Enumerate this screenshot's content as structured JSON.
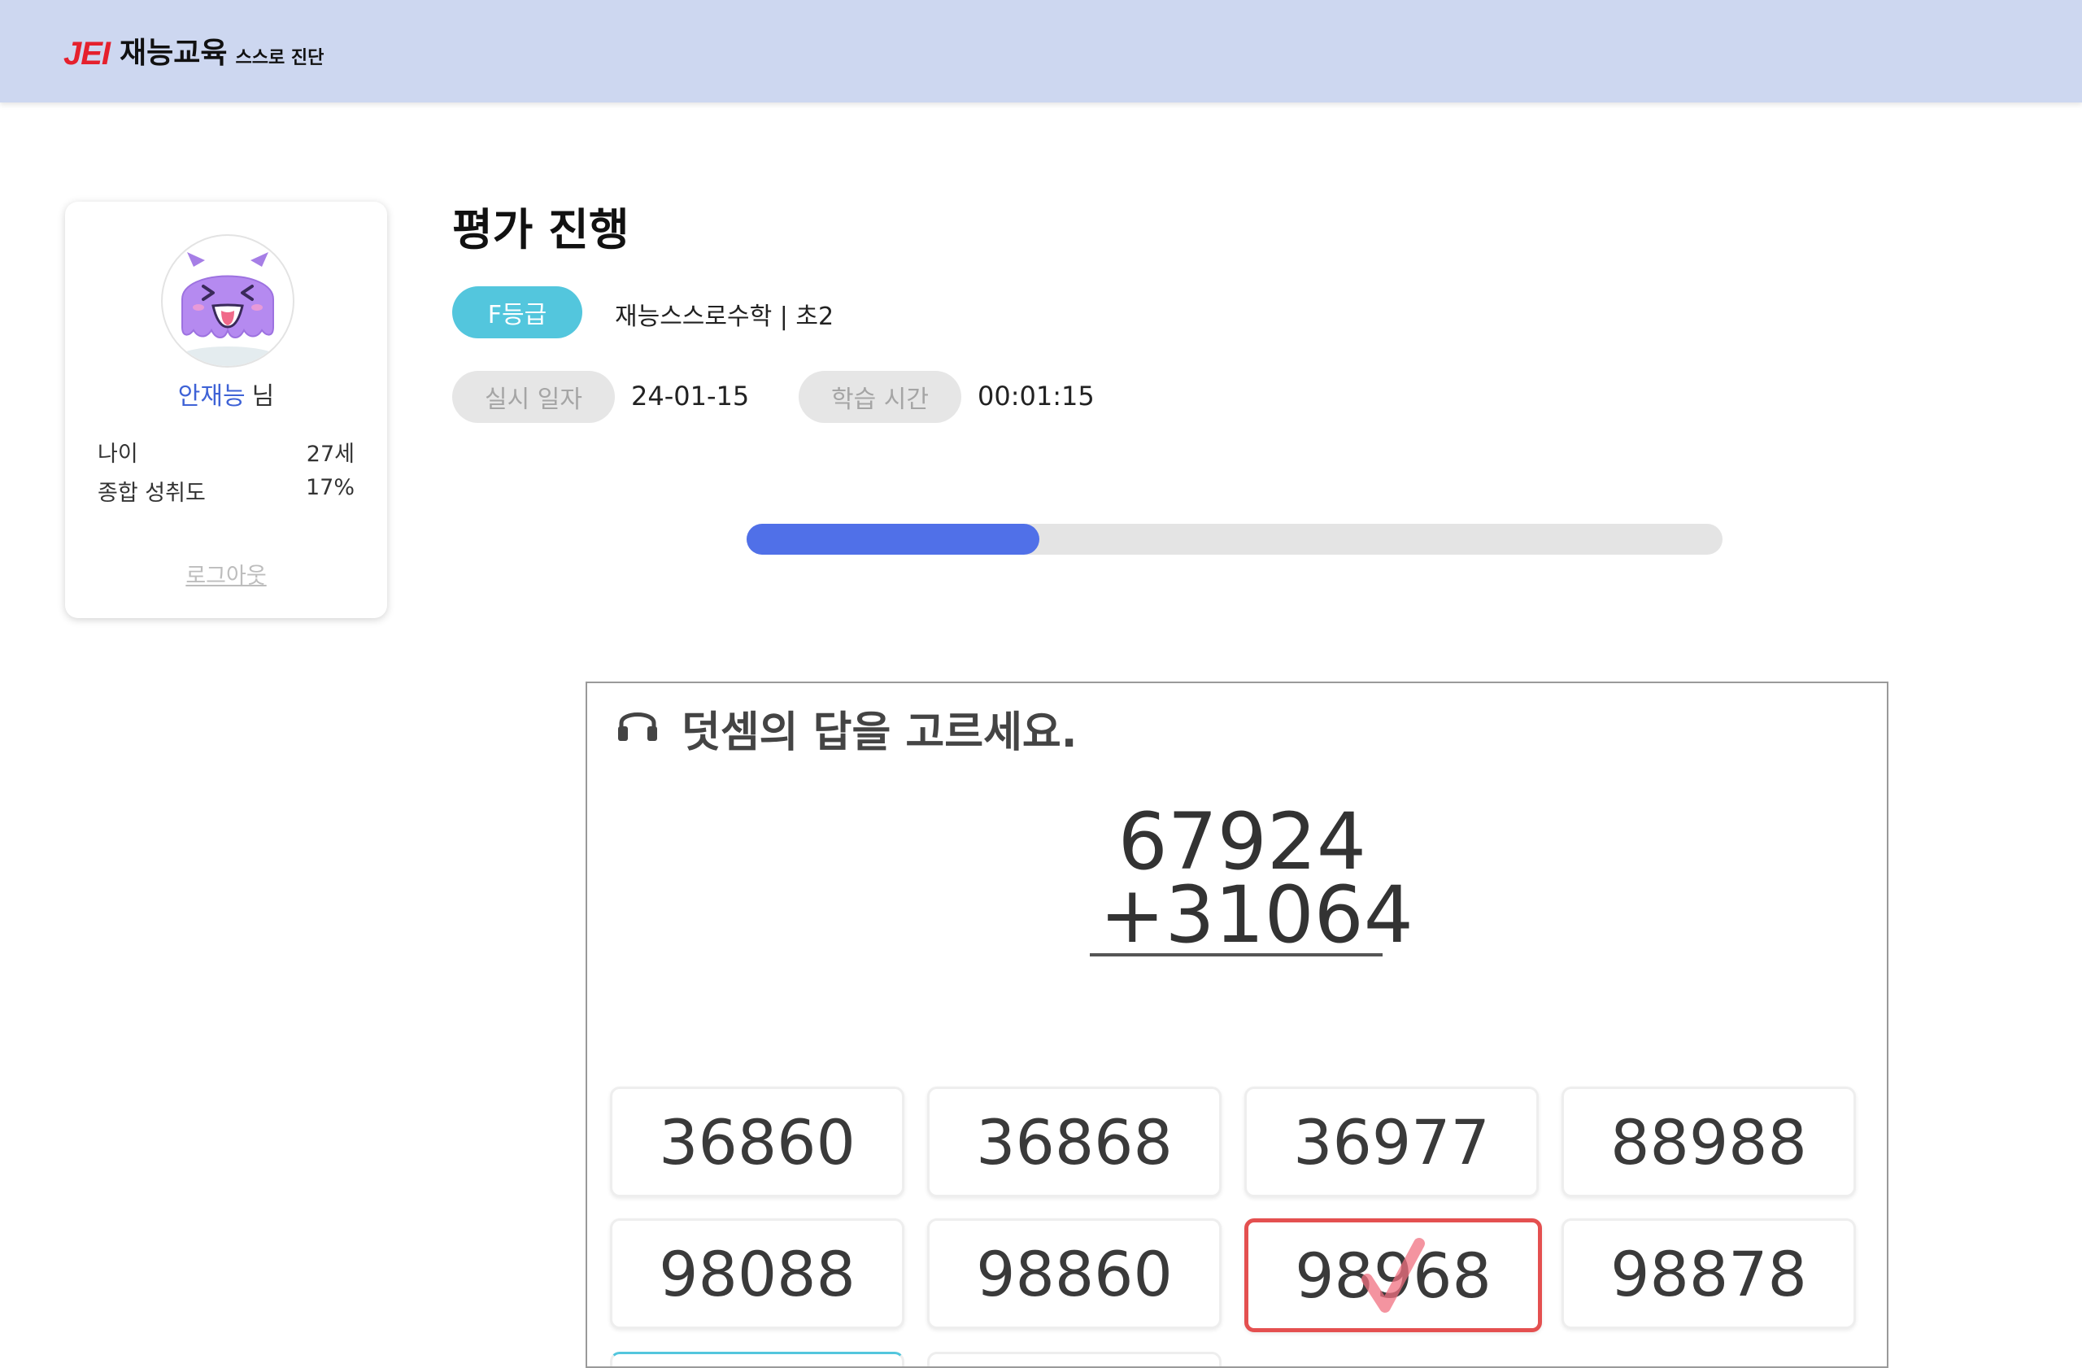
{
  "header": {
    "logo_jei": "JEI",
    "logo_brand": "재능교육",
    "logo_sub": "스스로 진단"
  },
  "profile": {
    "avatar": "purple-monster-avatar",
    "name": "안재능",
    "suffix": "님",
    "stats": [
      {
        "label": "나이",
        "value": "27세"
      },
      {
        "label": "종합 성취도",
        "value": "17%"
      }
    ],
    "logout_label": "로그아웃"
  },
  "main": {
    "title": "평가 진행",
    "grade_badge": "F등급",
    "course": "재능스스로수학 | 초2",
    "date_label": "실시 일자",
    "date_value": "24-01-15",
    "time_label": "학습 시간",
    "time_value": "00:01:15",
    "progress": 0.3
  },
  "question": {
    "icon": "headphones-icon",
    "instruction": "덧셈의 답을 고르세요.",
    "operand1": "67924",
    "operator": "+",
    "operand2": "31064",
    "choices": [
      "36860",
      "36868",
      "36977",
      "88988",
      "98088",
      "98860",
      "98968",
      "98878"
    ],
    "selected_index": 6
  },
  "colors": {
    "header_bg": "#cdd7f0",
    "brand_red": "#e5202d",
    "grade_badge": "#53c6dd",
    "progress_fill": "#5070e8",
    "selected_border": "#e45050",
    "username": "#3e62d6"
  }
}
